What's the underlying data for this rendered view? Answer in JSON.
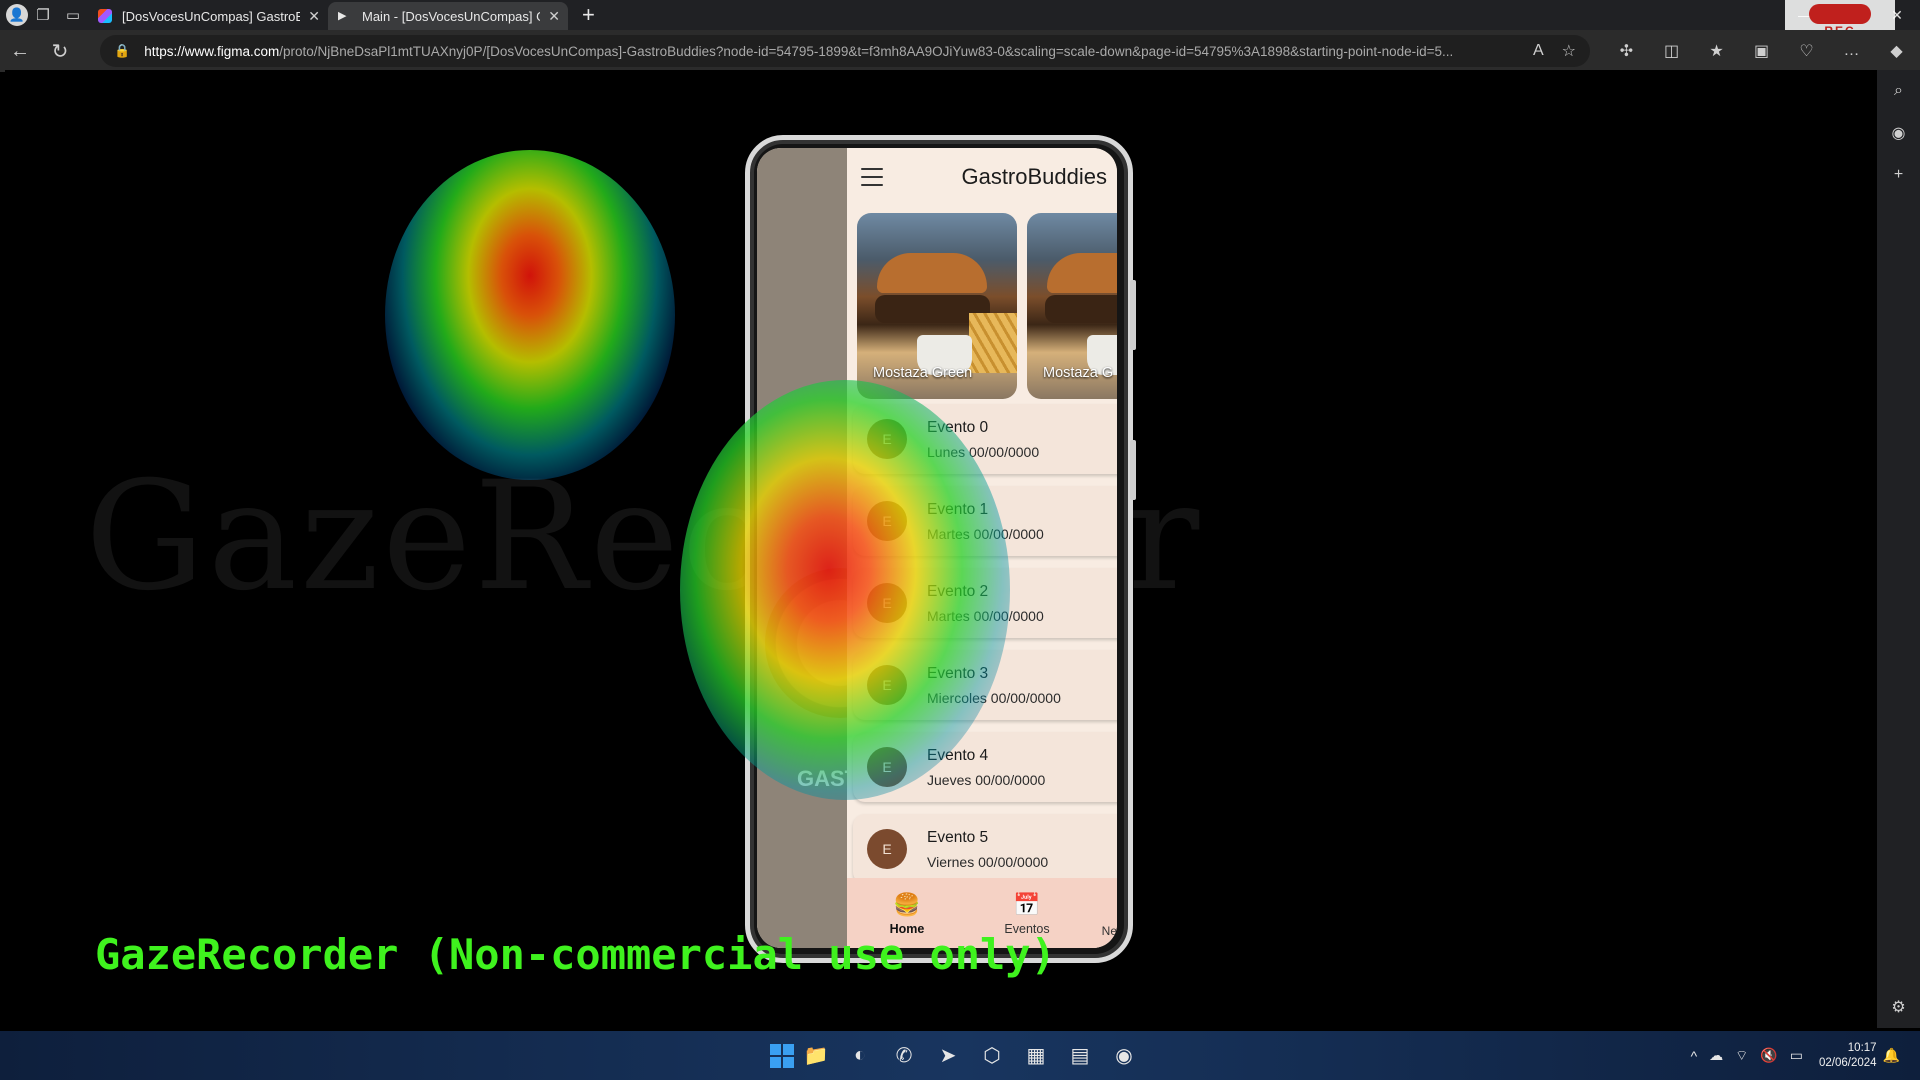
{
  "browser": {
    "tabs": [
      {
        "label": "[DosVocesUnCompas] GastroBuc",
        "favicon": "figma-icon"
      },
      {
        "label": "Main - [DosVocesUnCompas] Ga",
        "favicon": "play-icon"
      }
    ],
    "url_host": "https://www.figma.com",
    "url_rest": "/proto/NjBneDsaPl1mtTUAXnyj0P/[DosVocesUnCompas]-GastroBuddies?node-id=54795-1899&t=f3mh8AA9OJiYuw83-0&scaling=scale-down&page-id=54795%3A1898&starting-point-node-id=5...",
    "rec_label": "REC"
  },
  "overlay": {
    "watermark": "GazeRecorder",
    "banner": "GazeRecorder (Non-commercial use only)"
  },
  "app": {
    "title": "GastroBuddies",
    "drawer_logo_text": "GAST",
    "carousel": [
      {
        "name": "Mostaza Green"
      },
      {
        "name": "Mostaza G"
      }
    ],
    "events": [
      {
        "avatar": "E",
        "name": "Evento 0",
        "date": "Lunes 00/00/0000"
      },
      {
        "avatar": "E",
        "name": "Evento 1",
        "date": "Martes 00/00/0000"
      },
      {
        "avatar": "E",
        "name": "Evento 2",
        "date": "Martes 00/00/0000"
      },
      {
        "avatar": "E",
        "name": "Evento 3",
        "date": "Miercoles 00/00/0000"
      },
      {
        "avatar": "E",
        "name": "Evento 4",
        "date": "Jueves 00/00/0000"
      },
      {
        "avatar": "E",
        "name": "Evento 5",
        "date": "Viernes 00/00/0000"
      }
    ],
    "bottom_nav": [
      {
        "label": "Home",
        "icon": "home-logo-icon"
      },
      {
        "label": "Eventos",
        "icon": "calendar-clock-icon"
      }
    ],
    "bottom_nav_more": "Ne"
  },
  "taskbar": {
    "time": "10:17",
    "date": "02/06/2024"
  }
}
